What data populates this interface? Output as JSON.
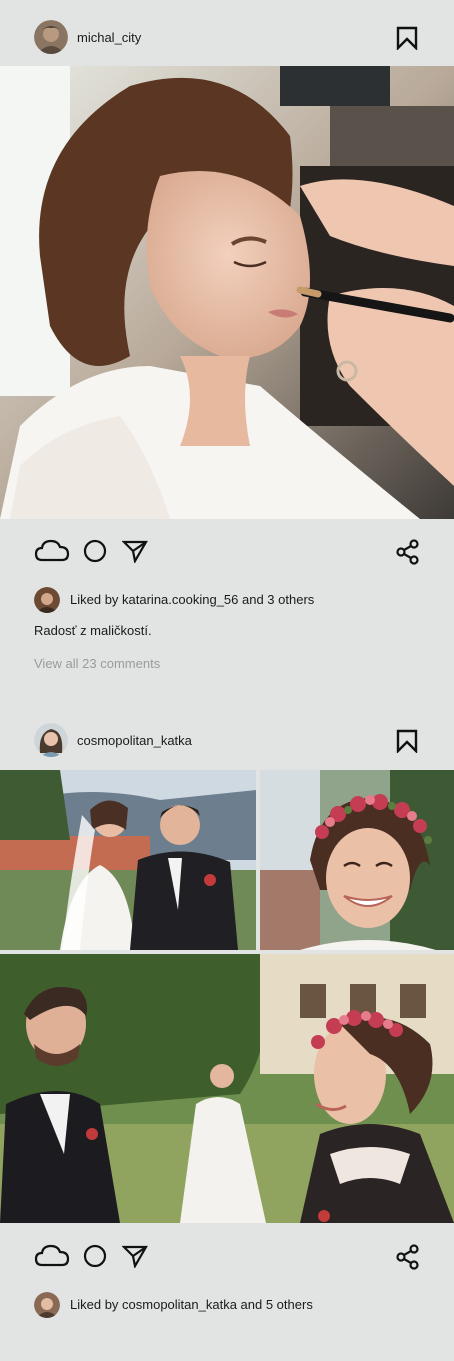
{
  "posts": [
    {
      "username": "michal_city",
      "liked_by": "Liked by katarina.cooking_56 and 3 others",
      "caption": "Radosť z maličkostí.",
      "comments_link": "View all 23 comments"
    },
    {
      "username": "cosmopolitan_katka",
      "liked_by": "Liked by cosmopolitan_katka and 5 others"
    }
  ],
  "icons": {
    "like": "cloud-icon",
    "comment": "circle-icon",
    "share_send": "send-icon",
    "share": "share-icon",
    "bookmark": "bookmark-icon"
  },
  "colors": {
    "background": "#e1e4e3",
    "text": "#1b1b1b",
    "muted": "#9a9c9c"
  }
}
